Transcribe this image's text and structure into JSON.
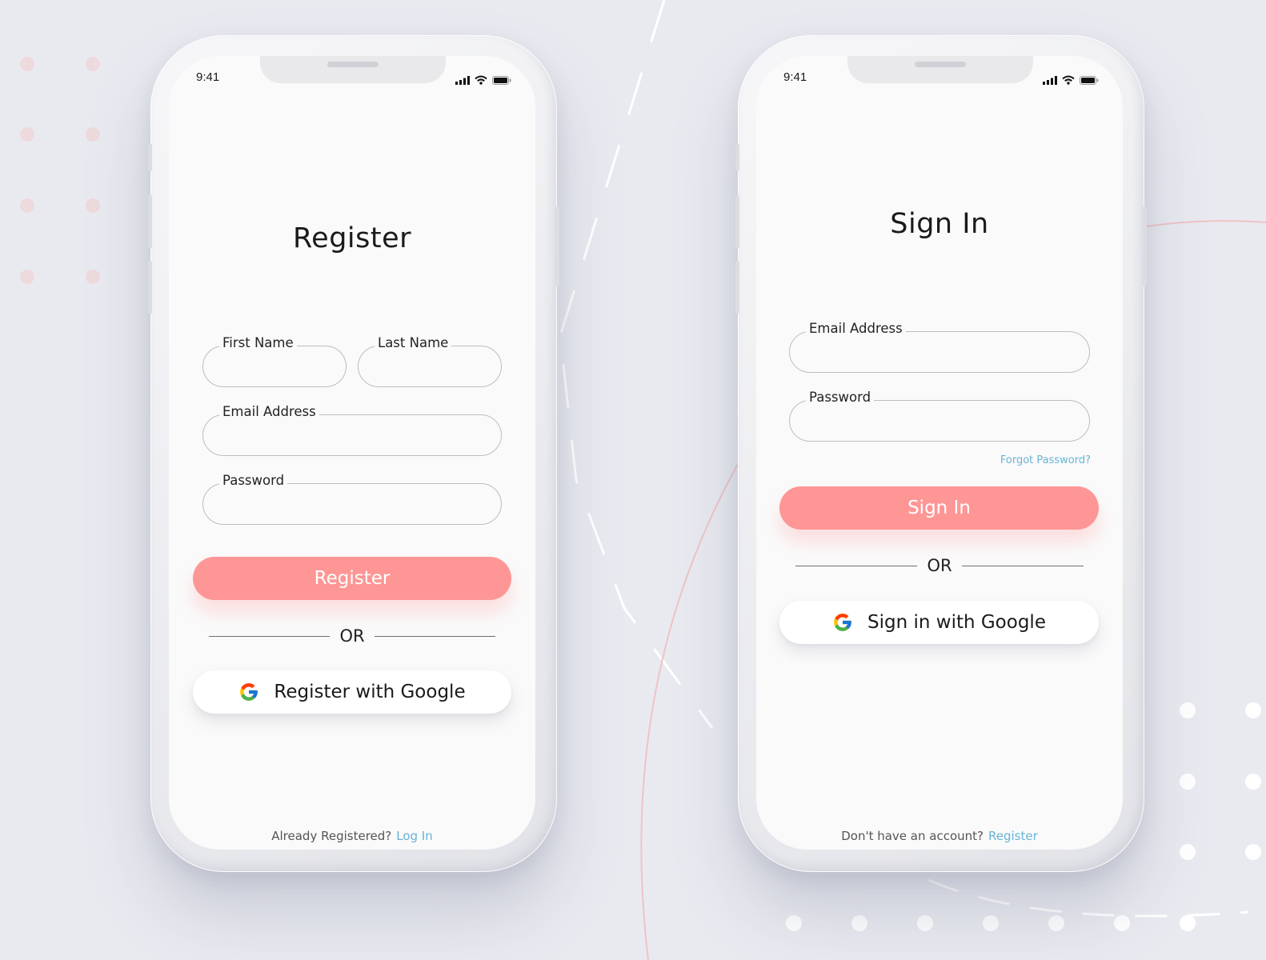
{
  "colors": {
    "background": "#e9eaf0",
    "accent": "#fe9696",
    "link": "#68b3d7",
    "screen": "#fafafa",
    "field_border": "#bdbdbd"
  },
  "register_screen": {
    "status_time": "9:41",
    "title": "Register",
    "fields": {
      "first_name_label": "First Name",
      "last_name_label": "Last Name",
      "email_label": "Email Address",
      "password_label": "Password"
    },
    "primary_button": "Register",
    "divider": "OR",
    "google_button": "Register with Google",
    "footer_text": "Already Registered?",
    "footer_link": "Log In"
  },
  "signin_screen": {
    "status_time": "9:41",
    "title": "Sign In",
    "fields": {
      "email_label": "Email Address",
      "password_label": "Password"
    },
    "forgot_link": "Forgot Password?",
    "primary_button": "Sign In",
    "divider": "OR",
    "google_button": "Sign in with Google",
    "footer_text": "Don't have an account?",
    "footer_link": "Register"
  },
  "icons": [
    "signal-icon",
    "wifi-icon",
    "battery-icon",
    "google-icon"
  ]
}
